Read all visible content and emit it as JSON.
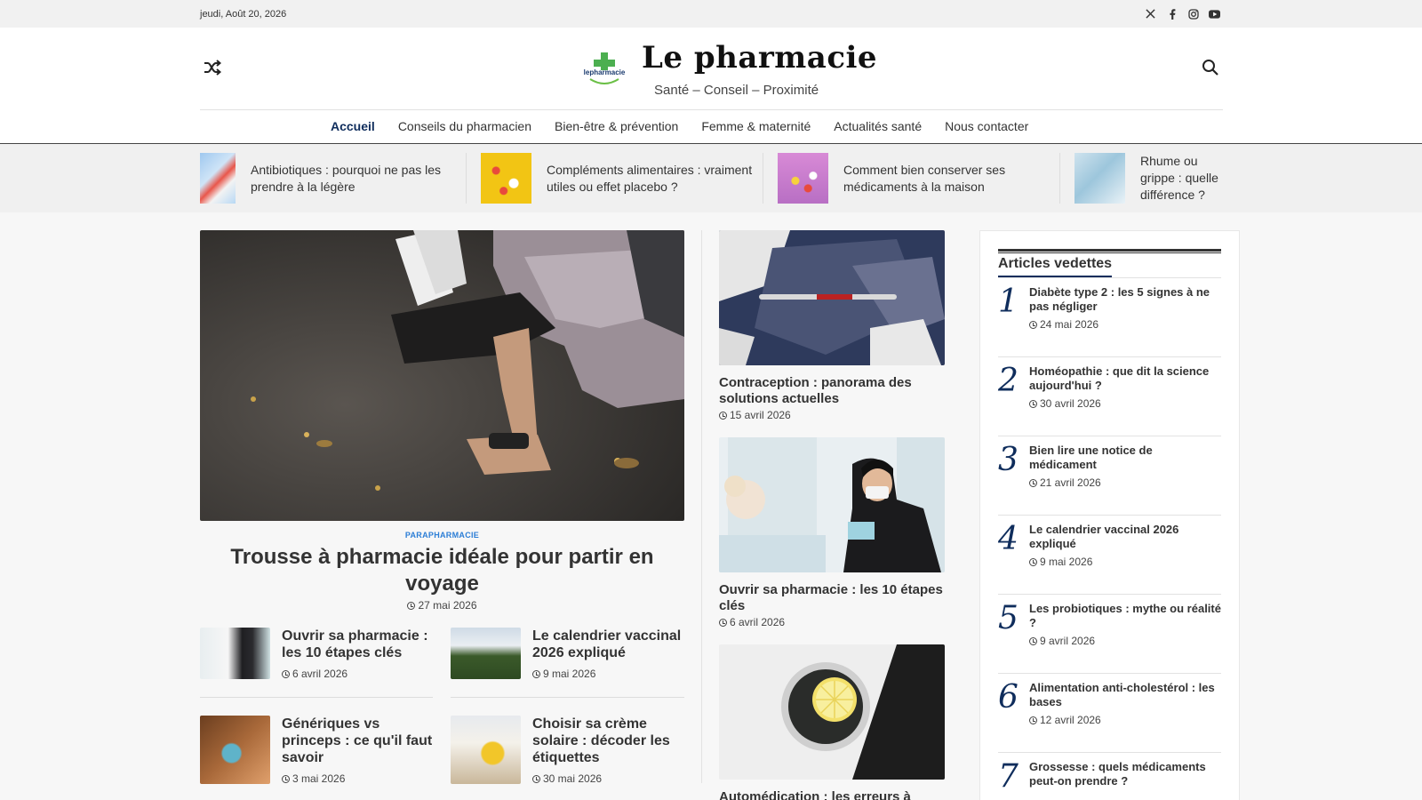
{
  "topbar": {
    "date": "jeudi, Août 20, 2026",
    "social": [
      "x-icon",
      "facebook-icon",
      "instagram-icon",
      "youtube-icon"
    ]
  },
  "header": {
    "logo_text": "lepharmacie",
    "site_title": "Le pharmacie",
    "tagline": "Santé – Conseil – Proximité"
  },
  "nav": {
    "items": [
      "Accueil",
      "Conseils du pharmacien",
      "Bien-être & prévention",
      "Femme & maternité",
      "Actualités santé",
      "Nous contacter"
    ],
    "active": "Accueil"
  },
  "ticker": [
    {
      "title": "Antibiotiques : pourquoi ne pas les prendre à la légère"
    },
    {
      "title": "Compléments alimentaires : vraiment utiles ou effet placebo ?"
    },
    {
      "title": "Comment bien conserver ses médicaments à la maison"
    },
    {
      "title": "Rhume ou grippe : quelle différence ?"
    }
  ],
  "hero": {
    "category": "PARAPHARMACIE",
    "title": "Trousse à pharmacie idéale pour partir en voyage",
    "date": "27 mai 2026"
  },
  "small_posts": [
    {
      "title": "Ouvrir sa pharmacie : les 10 étapes clés",
      "date": "6 avril 2026"
    },
    {
      "title": "Le calendrier vaccinal 2026 expliqué",
      "date": "9 mai 2026"
    },
    {
      "title": "Génériques vs princeps : ce qu'il faut savoir",
      "date": "3 mai 2026"
    },
    {
      "title": "Choisir sa crème solaire : décoder les étiquettes",
      "date": "30 mai 2026"
    }
  ],
  "mid_posts": [
    {
      "title": "Contraception : panorama des solutions actuelles",
      "date": "15 avril 2026"
    },
    {
      "title": "Ouvrir sa pharmacie : les 10 étapes clés",
      "date": "6 avril 2026"
    },
    {
      "title": "Automédication : les erreurs à",
      "date": ""
    }
  ],
  "sidebar": {
    "title": "Articles vedettes",
    "items": [
      {
        "num": "1",
        "title": "Diabète type 2 : les 5 signes à ne pas négliger",
        "date": "24 mai 2026"
      },
      {
        "num": "2",
        "title": "Homéopathie : que dit la science aujourd'hui ?",
        "date": "30 avril 2026"
      },
      {
        "num": "3",
        "title": "Bien lire une notice de médicament",
        "date": "21 avril 2026"
      },
      {
        "num": "4",
        "title": "Le calendrier vaccinal 2026 expliqué",
        "date": "9 mai 2026"
      },
      {
        "num": "5",
        "title": "Les probiotiques : mythe ou réalité ?",
        "date": "9 avril 2026"
      },
      {
        "num": "6",
        "title": "Alimentation anti-cholestérol : les bases",
        "date": "12 avril 2026"
      },
      {
        "num": "7",
        "title": "Grossesse : quels médicaments peut-on prendre ?",
        "date": ""
      }
    ]
  },
  "colors": {
    "accent": "#0f2d5c",
    "category": "#2c7ed6",
    "topbar_bg": "#f1f1f1",
    "ticker_bg": "#f0f0f0"
  }
}
